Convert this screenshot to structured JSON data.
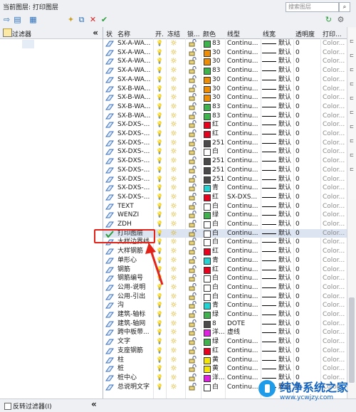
{
  "top_bar": {
    "current_layer_label": "当前图层: 打印图层",
    "search_placeholder": "搜索图层",
    "search_icon": "search-icon"
  },
  "left_panel": {
    "title": "过滤器",
    "collapse_glyph": "«",
    "invert_filter_label": "反转过滤器(I)"
  },
  "columns": [
    "状",
    "名称",
    "开.",
    "冻结",
    "锁...",
    "颜色",
    "线型",
    "线宽",
    "透明度",
    "打印..."
  ],
  "colors": {
    "green": "#3cb44b",
    "orange": "#f08c00",
    "red": "#e8001c",
    "gray": "#4a4a4a",
    "white": "#ffffff",
    "cyan": "#22d3d3",
    "magenta": "#e020e0",
    "yellow": "#f5e600",
    "blue": "#2a4bd7",
    "accent": "#e2231a"
  },
  "layers": [
    {
      "name": "SX-A-WA...",
      "color_name": "83",
      "swatch": "green",
      "linetype": "Continu...",
      "lineweight": "默认",
      "transparency": "0",
      "plot_style": "Color..."
    },
    {
      "name": "SX-A-WA...",
      "color_name": "30",
      "swatch": "orange",
      "linetype": "Continu...",
      "lineweight": "默认",
      "transparency": "0",
      "plot_style": "Color..."
    },
    {
      "name": "SX-A-WA...",
      "color_name": "30",
      "swatch": "orange",
      "linetype": "Continu...",
      "lineweight": "默认",
      "transparency": "0",
      "plot_style": "Color..."
    },
    {
      "name": "SX-A-WA...",
      "color_name": "83",
      "swatch": "green",
      "linetype": "Continu...",
      "lineweight": "默认",
      "transparency": "0",
      "plot_style": "Color..."
    },
    {
      "name": "SX-A-WA...",
      "color_name": "30",
      "swatch": "orange",
      "linetype": "Continu...",
      "lineweight": "默认",
      "transparency": "0",
      "plot_style": "Color..."
    },
    {
      "name": "SX-B-WA...",
      "color_name": "30",
      "swatch": "orange",
      "linetype": "Continu...",
      "lineweight": "默认",
      "transparency": "0",
      "plot_style": "Color..."
    },
    {
      "name": "SX-B-WA...",
      "color_name": "30",
      "swatch": "orange",
      "linetype": "Continu...",
      "lineweight": "默认",
      "transparency": "0",
      "plot_style": "Color..."
    },
    {
      "name": "SX-B-WA...",
      "color_name": "83",
      "swatch": "green",
      "linetype": "Continu...",
      "lineweight": "默认",
      "transparency": "0",
      "plot_style": "Color..."
    },
    {
      "name": "SX-B-WA...",
      "color_name": "83",
      "swatch": "green",
      "linetype": "Continu...",
      "lineweight": "默认",
      "transparency": "0",
      "plot_style": "Color..."
    },
    {
      "name": "SX-DXS-...",
      "color_name": "红",
      "swatch": "red",
      "linetype": "Continu...",
      "lineweight": "默认",
      "transparency": "0",
      "plot_style": "Color..."
    },
    {
      "name": "SX-DXS-...",
      "color_name": "红",
      "swatch": "red",
      "linetype": "Continu...",
      "lineweight": "默认",
      "transparency": "0",
      "plot_style": "Color..."
    },
    {
      "name": "SX-DXS-...",
      "color_name": "251",
      "swatch": "gray",
      "linetype": "Continu...",
      "lineweight": "默认",
      "transparency": "0",
      "plot_style": "Color..."
    },
    {
      "name": "SX-DXS-...",
      "color_name": "白",
      "swatch": "white",
      "linetype": "Continu...",
      "lineweight": "默认",
      "transparency": "0",
      "plot_style": "Color..."
    },
    {
      "name": "SX-DXS-...",
      "color_name": "251",
      "swatch": "gray",
      "linetype": "Continu...",
      "lineweight": "默认",
      "transparency": "0",
      "plot_style": "Color..."
    },
    {
      "name": "SX-DXS-...",
      "color_name": "251",
      "swatch": "gray",
      "linetype": "Continu...",
      "lineweight": "默认",
      "transparency": "0",
      "plot_style": "Color..."
    },
    {
      "name": "SX-DXS-...",
      "color_name": "251",
      "swatch": "gray",
      "linetype": "Continu...",
      "lineweight": "默认",
      "transparency": "0",
      "plot_style": "Color..."
    },
    {
      "name": "SX-DXS-...",
      "color_name": "青",
      "swatch": "cyan",
      "linetype": "Continu...",
      "lineweight": "默认",
      "transparency": "0",
      "plot_style": "Color..."
    },
    {
      "name": "SX-DXS-...",
      "color_name": "红",
      "swatch": "red",
      "linetype": "SX-DXS...",
      "lineweight": "默认",
      "transparency": "0",
      "plot_style": "Color..."
    },
    {
      "name": "TEXT",
      "color_name": "白",
      "swatch": "white",
      "linetype": "Continu...",
      "lineweight": "默认",
      "transparency": "0",
      "plot_style": "Color..."
    },
    {
      "name": "WENZI",
      "color_name": "绿",
      "swatch": "green",
      "linetype": "Continu...",
      "lineweight": "默认",
      "transparency": "0",
      "plot_style": "Color..."
    },
    {
      "name": "ZDH",
      "color_name": "白",
      "swatch": "white",
      "linetype": "Continu...",
      "lineweight": "默认",
      "transparency": "0",
      "plot_style": "Color..."
    },
    {
      "name": "打印图层",
      "color_name": "白",
      "swatch": "white",
      "linetype": "Continu...",
      "lineweight": "默认",
      "transparency": "0",
      "plot_style": "Color...",
      "current": true
    },
    {
      "name": "大样边界线",
      "color_name": "白",
      "swatch": "white",
      "linetype": "Continu...",
      "lineweight": "默认",
      "transparency": "0",
      "plot_style": "Color..."
    },
    {
      "name": "大样钢筋",
      "color_name": "红",
      "swatch": "red",
      "linetype": "Continu...",
      "lineweight": "默认",
      "transparency": "0",
      "plot_style": "Color..."
    },
    {
      "name": "单形心",
      "color_name": "青",
      "swatch": "cyan",
      "linetype": "Continu...",
      "lineweight": "默认",
      "transparency": "0",
      "plot_style": "Color..."
    },
    {
      "name": "钢筋",
      "color_name": "红",
      "swatch": "red",
      "linetype": "Continu...",
      "lineweight": "默认",
      "transparency": "0",
      "plot_style": "Color..."
    },
    {
      "name": "钢筋编号",
      "color_name": "白",
      "swatch": "white",
      "linetype": "Continu...",
      "lineweight": "默认",
      "transparency": "0",
      "plot_style": "Color..."
    },
    {
      "name": "公用-说明",
      "color_name": "白",
      "swatch": "white",
      "linetype": "Continu...",
      "lineweight": "默认",
      "transparency": "0",
      "plot_style": "Color..."
    },
    {
      "name": "公用-引出",
      "color_name": "白",
      "swatch": "white",
      "linetype": "Continu...",
      "lineweight": "默认",
      "transparency": "0",
      "plot_style": "Color..."
    },
    {
      "name": "沟",
      "color_name": "青",
      "swatch": "cyan",
      "linetype": "Continu...",
      "lineweight": "默认",
      "transparency": "0",
      "plot_style": "Color..."
    },
    {
      "name": "建筑-轴标",
      "color_name": "绿",
      "swatch": "green",
      "linetype": "Continu...",
      "lineweight": "默认",
      "transparency": "0",
      "plot_style": "Color..."
    },
    {
      "name": "建筑-轴网",
      "color_name": "8",
      "swatch": "gray",
      "linetype": "DOTE",
      "lineweight": "默认",
      "transparency": "0",
      "plot_style": "Color..."
    },
    {
      "name": "跨中板带...",
      "color_name": "洋...",
      "swatch": "magenta",
      "linetype": "虚线",
      "lineweight": "默认",
      "transparency": "0",
      "plot_style": "Color..."
    },
    {
      "name": "文字",
      "color_name": "绿",
      "swatch": "green",
      "linetype": "Continu...",
      "lineweight": "默认",
      "transparency": "0",
      "plot_style": "Color..."
    },
    {
      "name": "支座钢筋",
      "color_name": "红",
      "swatch": "red",
      "linetype": "Continu...",
      "lineweight": "默认",
      "transparency": "0",
      "plot_style": "Color..."
    },
    {
      "name": "柱",
      "color_name": "黄",
      "swatch": "yellow",
      "linetype": "Continu...",
      "lineweight": "默认",
      "transparency": "0",
      "plot_style": "Color..."
    },
    {
      "name": "桩",
      "color_name": "黄",
      "swatch": "yellow",
      "linetype": "Continu...",
      "lineweight": "默认",
      "transparency": "0",
      "plot_style": "Color..."
    },
    {
      "name": "桩中心",
      "color_name": "洋...",
      "swatch": "magenta",
      "linetype": "Continu...",
      "lineweight": "默认",
      "transparency": "0",
      "plot_style": "Color..."
    },
    {
      "name": "总说明文字",
      "color_name": "白",
      "swatch": "white",
      "linetype": "Continu...",
      "lineweight": "默认",
      "transparency": "0",
      "plot_style": "Color..."
    }
  ],
  "watermark": {
    "name": "纯净系统之家",
    "url": "www.ycwjzy.com"
  }
}
